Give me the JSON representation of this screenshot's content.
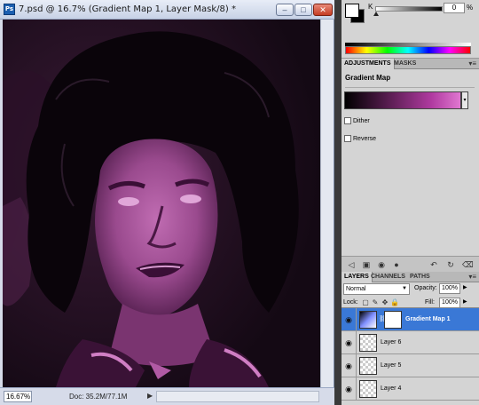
{
  "document": {
    "app_icon": "Ps",
    "title": "7.psd @ 16.7% (Gradient Map 1, Layer Mask/8) *",
    "window_buttons": [
      "–",
      "□",
      "✕"
    ],
    "zoom": "16.67%",
    "doc_info": "Doc: 35.2M/77.1M",
    "status_arrow": "▶"
  },
  "color_panel": {
    "channel": "K",
    "value": "0",
    "unit": "%"
  },
  "adjustments": {
    "tabs": [
      "ADJUSTMENTS",
      "MASKS"
    ],
    "menu": "▾≡",
    "title": "Gradient Map",
    "dither_label": "Dither",
    "reverse_label": "Reverse",
    "gradient_colors": [
      "#000000",
      "#b03aa0",
      "#e077d0"
    ]
  },
  "layers": {
    "tabs": [
      "LAYERS",
      "CHANNELS",
      "PATHS"
    ],
    "menu": "▾≡",
    "blend_mode": "Normal",
    "opacity_label": "Opacity:",
    "opacity": "100%",
    "lock_label": "Lock:",
    "fill_label": "Fill:",
    "fill": "100%",
    "rows": [
      {
        "name": "Gradient Map 1",
        "selected": true
      },
      {
        "name": "Layer 6",
        "selected": false
      },
      {
        "name": "Layer 5",
        "selected": false
      },
      {
        "name": "Layer 4",
        "selected": false
      }
    ]
  },
  "colors": {
    "accent_selected": "#3a78d6",
    "canvas_bg": "#150b15",
    "portrait_tint": "#a64d98"
  }
}
